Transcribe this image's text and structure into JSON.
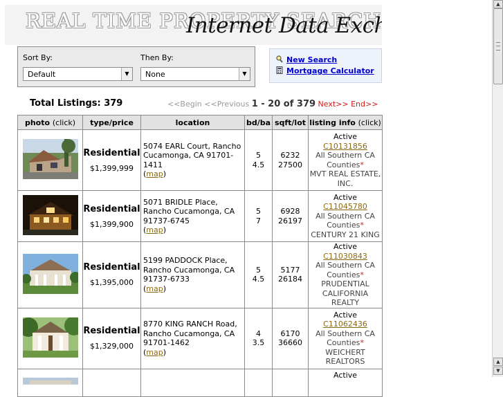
{
  "banner": {
    "background_text": "REAL TIME PROPERTY SEARCH",
    "title": "Internet Data Exchange"
  },
  "sort": {
    "sort_by_label": "Sort By:",
    "sort_by_value": "Default",
    "then_by_label": "Then By:",
    "then_by_value": "None"
  },
  "links": {
    "new_search": "New Search",
    "mortgage_calculator": "Mortgage Calculator"
  },
  "summary": {
    "total_label": "Total Listings:",
    "total_count": "379"
  },
  "pager": {
    "begin": "<<Begin",
    "previous": "<<Previous",
    "range": "1 - 20 of 379",
    "next": "Next>>",
    "end": "End>>"
  },
  "table": {
    "headers": {
      "photo": "photo",
      "photo_hint": "(click)",
      "type_price": "type/price",
      "location": "location",
      "bd_ba": "bd/ba",
      "sqft_lot": "sqft/lot",
      "listing_info": "listing info",
      "listing_info_hint": "(click)"
    },
    "map_label": "map",
    "rows": [
      {
        "type": "Residential",
        "price": "$1,399,999",
        "address": "5074 EARL Court, Rancho Cucamonga, CA 91701-1411",
        "beds": "5",
        "baths": "4.5",
        "sqft": "6232",
        "lot": "27500",
        "status": "Active",
        "mls": "C10131856",
        "area": "All Southern CA Counties",
        "broker": "MVT REAL ESTATE, INC."
      },
      {
        "type": "Residential",
        "price": "$1,399,900",
        "address": "5071 BRIDLE Place, Rancho Cucamonga, CA 91737-6745",
        "beds": "5",
        "baths": "7",
        "sqft": "6928",
        "lot": "26197",
        "status": "Active",
        "mls": "C11045780",
        "area": "All Southern CA Counties",
        "broker": "CENTURY 21 KING"
      },
      {
        "type": "Residential",
        "price": "$1,395,000",
        "address": "5199 PADDOCK Place, Rancho Cucamonga, CA 91737-6733",
        "beds": "5",
        "baths": "4.5",
        "sqft": "5177",
        "lot": "26184",
        "status": "Active",
        "mls": "C11030843",
        "area": "All Southern CA Counties",
        "broker": "PRUDENTIAL CALIFORNIA REALTY"
      },
      {
        "type": "Residential",
        "price": "$1,329,000",
        "address": "8770 KING RANCH Road, Rancho Cucamonga, CA 91701-1462",
        "beds": "4",
        "baths": "3.5",
        "sqft": "6170",
        "lot": "36660",
        "status": "Active",
        "mls": "C11062436",
        "area": "All Southern CA Counties",
        "broker": "WEICHERT REALTORS"
      },
      {
        "type": "",
        "price": "",
        "address": "",
        "beds": "",
        "baths": "",
        "sqft": "",
        "lot": "",
        "status": "Active",
        "mls": "",
        "area": "",
        "broker": ""
      }
    ]
  },
  "icons": {
    "new_search": "magnifier-icon",
    "mortgage_calculator": "calculator-icon",
    "select_arrow": "chevron-down-icon"
  }
}
